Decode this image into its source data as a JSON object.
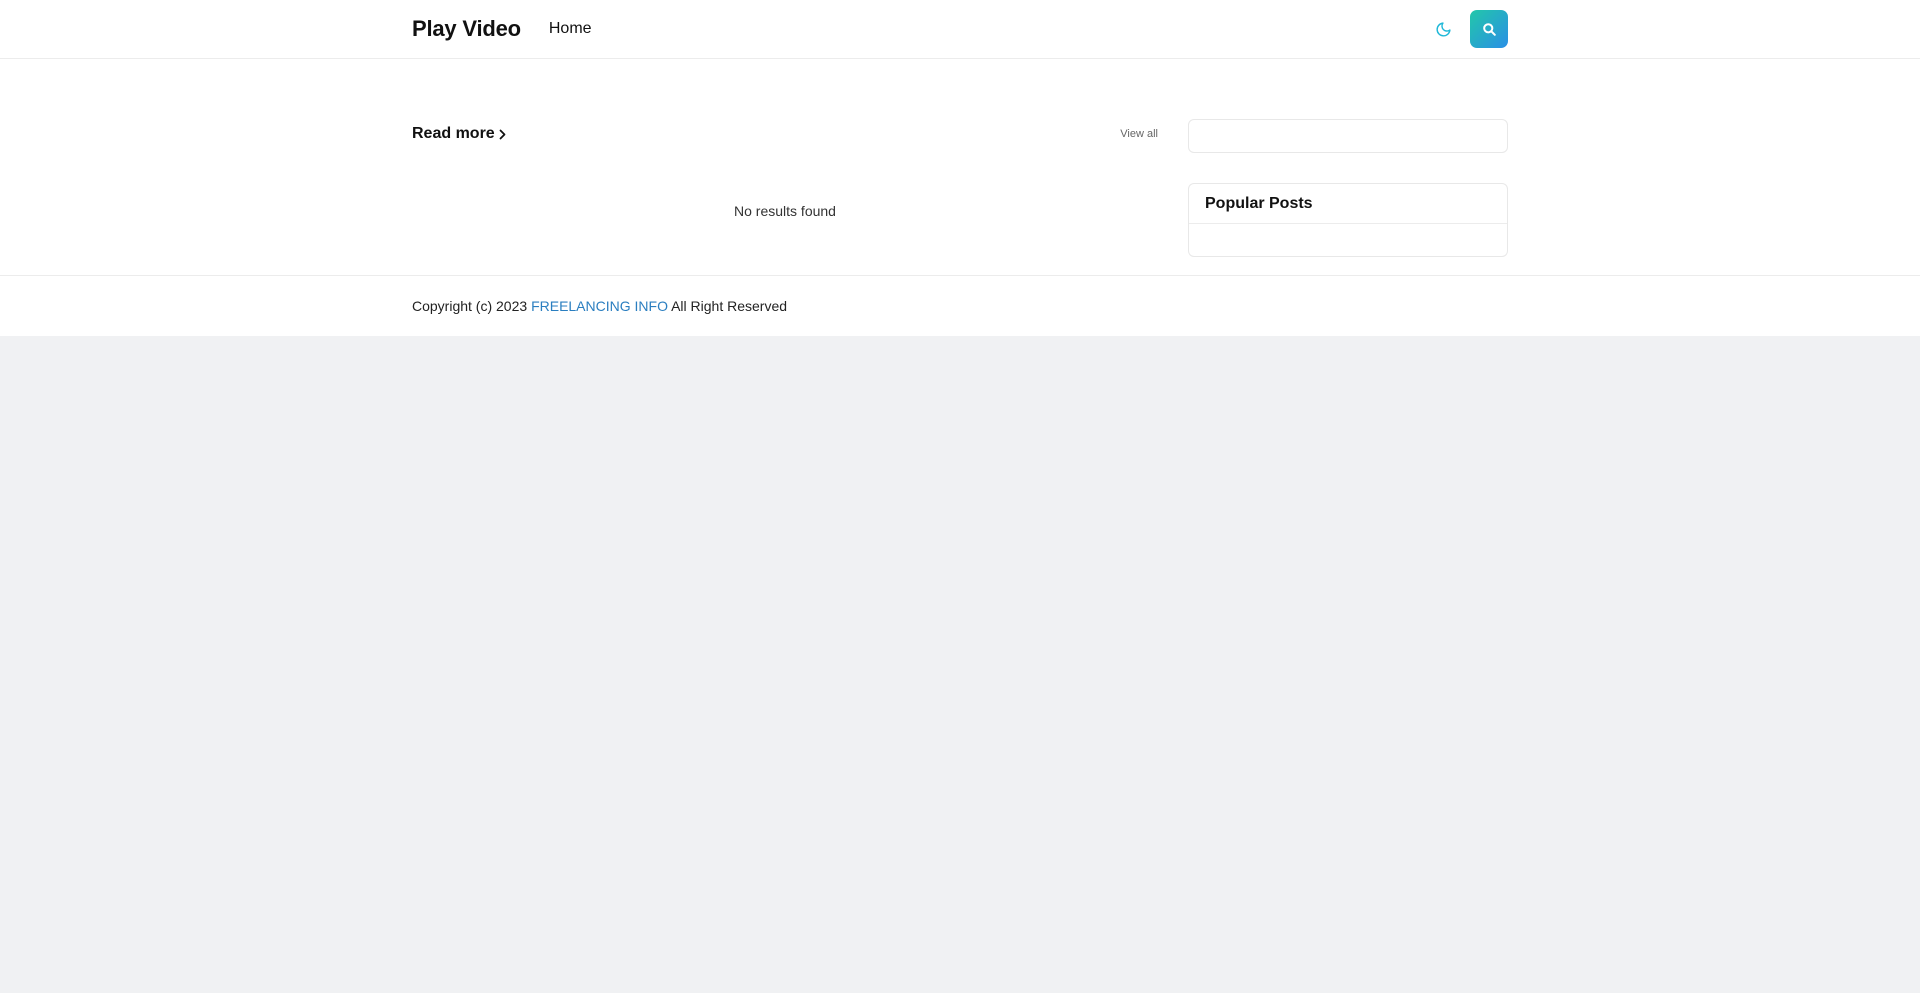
{
  "header": {
    "site_title": "Play Video",
    "nav": [
      {
        "label": "Home"
      }
    ],
    "dark_mode_icon": "moon-icon",
    "search_icon": "search-icon",
    "accent_gradient": [
      "#22c7a9",
      "#2a8fe6"
    ],
    "moon_color": "#1fb8d8"
  },
  "main": {
    "section_title": "Read more",
    "view_all_label": "View all",
    "empty_message": "No results found"
  },
  "sidebar": {
    "widget_title": "Popular Posts"
  },
  "footer": {
    "prefix": "Copyright (c) 2023",
    "link_text": "FREELANCING INFO",
    "suffix": "All Right Reserved",
    "link_color": "#2a7ec0"
  }
}
